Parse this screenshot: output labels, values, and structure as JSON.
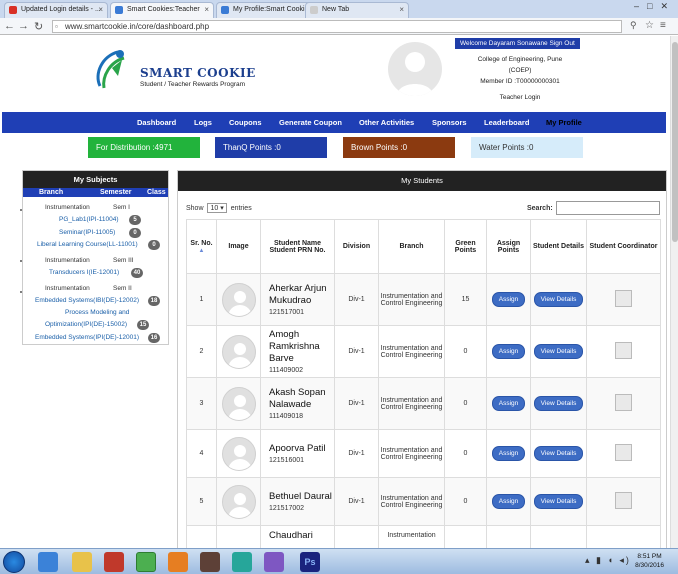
{
  "browser": {
    "tabs": [
      {
        "label": "Updated Login details - ...",
        "active": false,
        "favicon": "gmail-icon"
      },
      {
        "label": "Smart Cookies:Teacher",
        "active": true,
        "favicon": "cookie-icon"
      },
      {
        "label": "My Profile:Smart Cookies",
        "active": false,
        "favicon": "cookie-icon"
      },
      {
        "label": "New Tab",
        "active": false,
        "favicon": "blank-icon"
      }
    ],
    "url": "www.smartcookie.in/core/dashboard.php"
  },
  "header": {
    "logo_title": "SMART COOKIE",
    "logo_subtitle": "Student / Teacher Rewards Program",
    "welcome": "Welcome Dayaram Sonawane  Sign Out",
    "college": "College of Engineering, Pune",
    "college_short": "(COEP)",
    "member_id": "Member ID :T00000000301",
    "login_type": "Teacher Login"
  },
  "menu": [
    "Dashboard",
    "Logs",
    "Coupons",
    "Generate Coupon",
    "Other Activities",
    "Sponsors",
    "Leaderboard",
    "My Profile"
  ],
  "points": {
    "distribution": "For Distribution :4971",
    "thanq": "ThanQ Points :0",
    "brown": "Brown Points :0",
    "water": "Water Points :0"
  },
  "subjects": {
    "title": "My Subjects",
    "headers": [
      "Branch",
      "Semester",
      "Class"
    ],
    "groups": [
      {
        "branch": "Instrumentation",
        "sem": "Sem I"
      },
      {
        "branch": "Instrumentation",
        "sem": "Sem III"
      },
      {
        "branch": "Instrumentation",
        "sem": "Sem II"
      }
    ],
    "items": [
      {
        "label": "PG_Lab1(IPI-11004)",
        "count": "5"
      },
      {
        "label": "Seminar(IPI-11005)",
        "count": "0"
      },
      {
        "label": "Liberal Learning Course(LL-11001)",
        "count": "0"
      },
      {
        "label": "Transducers I(IE-12001)",
        "count": "40"
      },
      {
        "label": "Embedded Systems(IBI(DE)-12002)",
        "count": "18"
      },
      {
        "label": "Process Modeling and",
        "label2": "Optimization(IPI(DE)-15002)",
        "count": "15"
      },
      {
        "label": "Embedded Systems(IPI(DE)-12001)",
        "count": "16"
      }
    ]
  },
  "students": {
    "title": "My Students",
    "show_prefix": "Show",
    "show_value": "10",
    "show_suffix": "entries",
    "search_label": "Search:",
    "columns": [
      "Sr. No.",
      "Image",
      "Student Name Student PRN No.",
      "Division",
      "Branch",
      "Green Points",
      "Assign Points",
      "Student Details",
      "Student Coordinator"
    ],
    "rows": [
      {
        "sr": "1",
        "name": "Aherkar Arjun Mukudrao",
        "prn": "121517001",
        "division": "Div-1",
        "branch": "Instrumentation and Control Engineering",
        "points": "15"
      },
      {
        "sr": "2",
        "name": "Amogh Ramkrishna Barve",
        "prn": "111409002",
        "division": "Div-1",
        "branch": "Instrumentation and Control Engineering",
        "points": "0"
      },
      {
        "sr": "3",
        "name": "Akash Sopan Nalawade",
        "prn": "111409018",
        "division": "Div-1",
        "branch": "Instrumentation and Control Engineering",
        "points": "0"
      },
      {
        "sr": "4",
        "name": "Apoorva Patil",
        "prn": "121516001",
        "division": "Div-1",
        "branch": "Instrumentation and Control Engineering",
        "points": "0"
      },
      {
        "sr": "5",
        "name": "Bethuel Daural",
        "prn": "121517002",
        "division": "Div-1",
        "branch": "Instrumentation and Control Engineering",
        "points": "0"
      },
      {
        "sr": "",
        "name": "Chaudhari",
        "prn": "",
        "division": "",
        "branch": "Instrumentation",
        "points": ""
      }
    ],
    "assign_label": "Assign",
    "details_label": "View Details"
  },
  "taskbar": {
    "time": "8:51 PM",
    "date": "8/30/2016"
  },
  "colors": {
    "menu_blue": "#1f3fb5",
    "distribution_green": "#22b33c",
    "thanq_blue": "#1f3da8",
    "brown": "#8b3a10",
    "water": "#d6ecfa"
  }
}
